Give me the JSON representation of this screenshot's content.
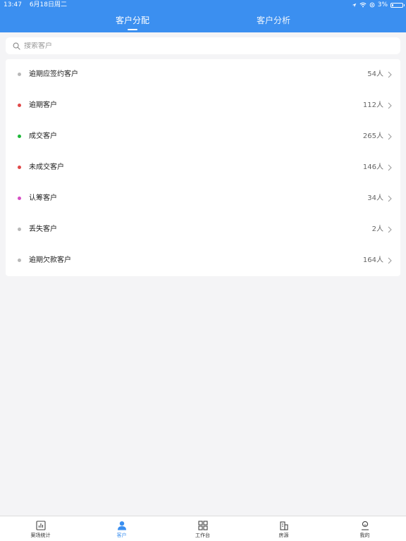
{
  "status_bar": {
    "time": "13:47",
    "date": "6月18日周二",
    "battery": "3%"
  },
  "tabs": [
    {
      "label": "客户分配",
      "active": true
    },
    {
      "label": "客户分析",
      "active": false
    }
  ],
  "search": {
    "placeholder": "搜索客户",
    "value": ""
  },
  "customer_list": [
    {
      "label": "逾期应签约客户",
      "count": "54人",
      "dot_color": "#b8b8b8"
    },
    {
      "label": "逾期客户",
      "count": "112人",
      "dot_color": "#e04848"
    },
    {
      "label": "成交客户",
      "count": "265人",
      "dot_color": "#1fb83a"
    },
    {
      "label": "未成交客户",
      "count": "146人",
      "dot_color": "#e04848"
    },
    {
      "label": "认筹客户",
      "count": "34人",
      "dot_color": "#d64fc4"
    },
    {
      "label": "丢失客户",
      "count": "2人",
      "dot_color": "#b8b8b8"
    },
    {
      "label": "逾期欠款客户",
      "count": "164人",
      "dot_color": "#b8b8b8"
    }
  ],
  "bottom_tabs": [
    {
      "label": "案场统计",
      "icon": "chart-icon",
      "active": false
    },
    {
      "label": "客户",
      "icon": "person-icon",
      "active": true
    },
    {
      "label": "工作台",
      "icon": "grid-icon",
      "active": false
    },
    {
      "label": "房源",
      "icon": "building-icon",
      "active": false
    },
    {
      "label": "我的",
      "icon": "profile-icon",
      "active": false
    }
  ],
  "colors": {
    "primary": "#3b8ff0",
    "background": "#f4f4f6",
    "inactive_icon": "#444444"
  }
}
